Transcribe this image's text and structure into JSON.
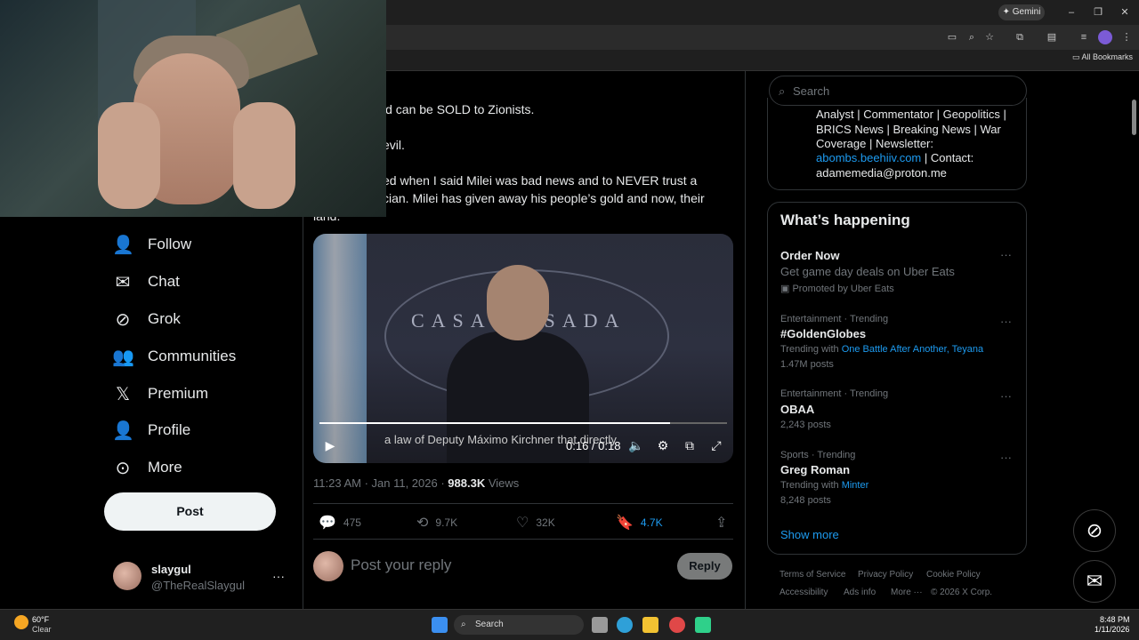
{
  "browser": {
    "gemini_label": "Gemini",
    "all_bookmarks": "All Bookmarks"
  },
  "sidebar": {
    "items": [
      {
        "label": "Follow",
        "icon": "follow-icon"
      },
      {
        "label": "Chat",
        "icon": "chat-icon"
      },
      {
        "label": "Grok",
        "icon": "grok-icon"
      },
      {
        "label": "Communities",
        "icon": "communities-icon"
      },
      {
        "label": "Premium",
        "icon": "x-icon"
      },
      {
        "label": "Profile",
        "icon": "profile-icon"
      },
      {
        "label": "More",
        "icon": "more-icon"
      }
    ],
    "post_label": "Post",
    "account": {
      "name": "slaygul",
      "handle": "@TheRealSlaygul"
    }
  },
  "tweet": {
    "lines": [
      ":",
      "ld can be SOLD to Zionists.",
      "evil.",
      "ed when I said Milei was bad news and to NEVER trust a",
      "cian. Milei has given away his people’s gold and now, their",
      "land."
    ],
    "video": {
      "caption": "a law of Deputy Máximo Kirchner that directly",
      "time": "0:16 / 0:18",
      "progress": 0.86,
      "sign_text": "CASA ROSADA"
    },
    "timestamp": "11:23 AM · Jan 11, 2026 · ",
    "views_count": "988.3K",
    "views_label": " Views",
    "actions": {
      "replies": "475",
      "reposts": "9.7K",
      "likes": "32K",
      "bookmarks": "4.7K"
    },
    "reply_placeholder": "Post your reply",
    "reply_button": "Reply"
  },
  "right": {
    "search_placeholder": "Search",
    "bio": {
      "line1": "Analyst | Commentator | Geopolitics |",
      "line2": "BRICS News | Breaking News | War",
      "line3": "Coverage | Newsletter:",
      "link": "abombs.beehiiv.com",
      "contact_label": " | Contact:",
      "email": "adamemedia@proton.me"
    },
    "happening_title": "What’s happening",
    "trends": [
      {
        "meta": "",
        "title": "Order Now",
        "sub": "Get game day deals on Uber Eats",
        "extra": "Promoted by Uber Eats"
      },
      {
        "meta": "Entertainment · Trending",
        "title": "#GoldenGlobes",
        "sub": "Trending with ",
        "link": "One Battle After Another, Teyana",
        "extra": "1.47M posts"
      },
      {
        "meta": "Entertainment · Trending",
        "title": "OBAA",
        "extra": "2,243 posts"
      },
      {
        "meta": "Sports · Trending",
        "title": "Greg Roman",
        "sub": "Trending with ",
        "link": "Minter",
        "extra": "8,248 posts"
      }
    ],
    "show_more": "Show more",
    "footer": [
      "Terms of Service",
      "Privacy Policy",
      "Cookie Policy",
      "Accessibility",
      "Ads info",
      "More ···",
      "© 2026 X Corp."
    ]
  },
  "taskbar": {
    "weather_temp": "60°F",
    "weather_desc": "Clear",
    "search_label": "Search",
    "time": "8:48 PM",
    "date": "1/11/2026"
  }
}
